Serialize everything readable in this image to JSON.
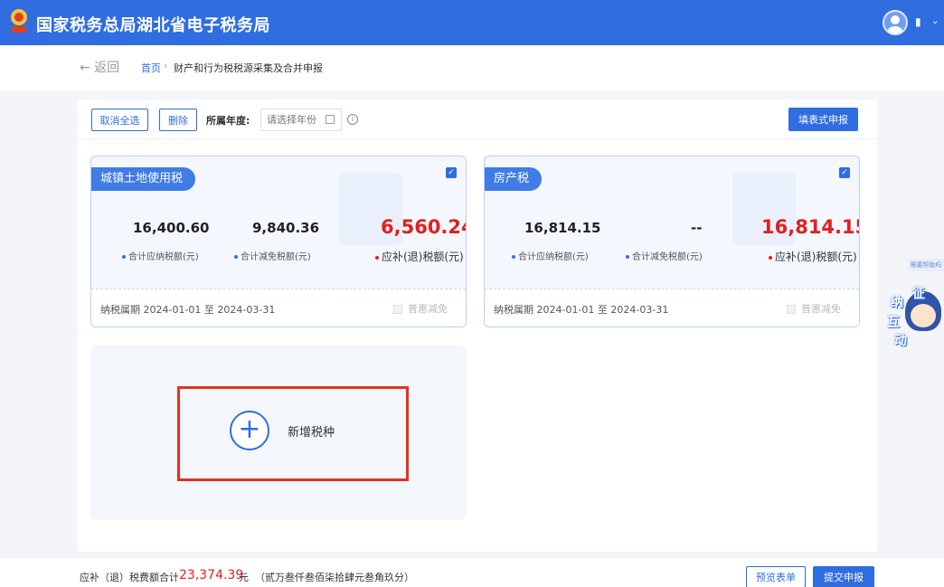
{
  "header": {
    "title": "国家税务总局湖北省电子税务局",
    "user_initial": "▮",
    "colors": {
      "brand": "#2f6de0",
      "highlight": "#e0341d",
      "amount": "#e02020"
    }
  },
  "breadcrumb": {
    "back": "← 返回",
    "home": "首页",
    "separator": "›",
    "current": "财产和行为税税源采集及合并申报"
  },
  "toolbar": {
    "deselect_all": "取消全选",
    "delete": "删除",
    "year_label": "所属年度:",
    "year_placeholder": "请选择年份",
    "fill_form": "填表式申报"
  },
  "cards": [
    {
      "tag": "城镇土地使用税",
      "checked": true,
      "payable": "16,400.60",
      "payable_label": "合计应纳税额(元)",
      "reduction": "9,840.36",
      "reduction_label": "合计减免税额(元)",
      "due": "6,560.24",
      "due_label": "应补(退)税额(元)",
      "period": "纳税属期 2024-01-01 至 2024-03-31",
      "relief": "普惠减免"
    },
    {
      "tag": "房产税",
      "checked": true,
      "payable": "16,814.15",
      "payable_label": "合计应纳税额(元)",
      "reduction": "--",
      "reduction_label": "合计减免税额(元)",
      "due": "16,814.15",
      "due_label": "应补(退)税额(元)",
      "period": "纳税属期 2024-01-01 至 2024-03-31",
      "relief": "普惠减免"
    }
  ],
  "add_tax": {
    "label": "新增税种"
  },
  "side_widget": {
    "tab": "需要帮助吗",
    "chars": [
      "纳",
      "征",
      "互",
      "动"
    ]
  },
  "footer": {
    "total_label": "应补（退）税费额合计",
    "total_amount": "23,374.39",
    "unit": "元",
    "amount_words": "（贰万叁仟叁佰柒拾肆元叁角玖分）",
    "preview": "预览表单",
    "submit": "提交申报"
  }
}
